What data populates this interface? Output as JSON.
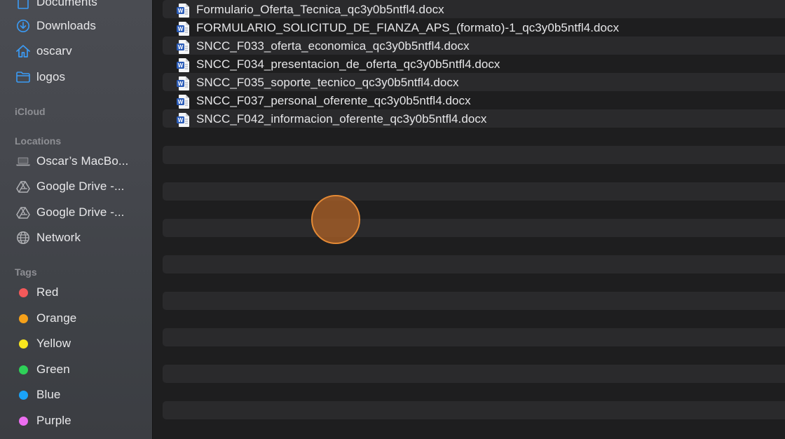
{
  "sidebar": {
    "favorites": [
      {
        "label": "Documents",
        "icon": "document-icon"
      },
      {
        "label": "Downloads",
        "icon": "download-icon"
      },
      {
        "label": "oscarv",
        "icon": "home-icon"
      },
      {
        "label": "logos",
        "icon": "folder-icon"
      }
    ],
    "icloud_header": "iCloud",
    "locations_header": "Locations",
    "locations": [
      {
        "label": "Oscar’s MacBo...",
        "icon": "laptop-icon"
      },
      {
        "label": "Google Drive -...",
        "icon": "google-drive-icon"
      },
      {
        "label": "Google Drive -...",
        "icon": "google-drive-icon"
      },
      {
        "label": "Network",
        "icon": "globe-icon"
      }
    ],
    "tags_header": "Tags",
    "tags": [
      {
        "label": "Red",
        "color": "#f4595a"
      },
      {
        "label": "Orange",
        "color": "#f6a11a"
      },
      {
        "label": "Yellow",
        "color": "#f8e61e"
      },
      {
        "label": "Green",
        "color": "#2ed158"
      },
      {
        "label": "Blue",
        "color": "#1aa3f8"
      },
      {
        "label": "Purple",
        "color": "#ec6ef0"
      }
    ]
  },
  "files": [
    "Formulario_Oferta_Tecnica_qc3y0b5ntfl4.docx",
    "FORMULARIO_SOLICITUD_DE_FIANZA_APS_(formato)-1_qc3y0b5ntfl4.docx",
    "SNCC_F033_oferta_economica_qc3y0b5ntfl4.docx",
    "SNCC_F034_presentacion_de_oferta_qc3y0b5ntfl4.docx",
    "SNCC_F035_soporte_tecnico_qc3y0b5ntfl4.docx",
    "SNCC_F037_personal_oferente_qc3y0b5ntfl4.docx",
    "SNCC_F042_informacion_oferente_qc3y0b5ntfl4.docx"
  ],
  "colors": {
    "accent_blue": "#3b9bf5",
    "click_indicator": "#e58a35"
  }
}
